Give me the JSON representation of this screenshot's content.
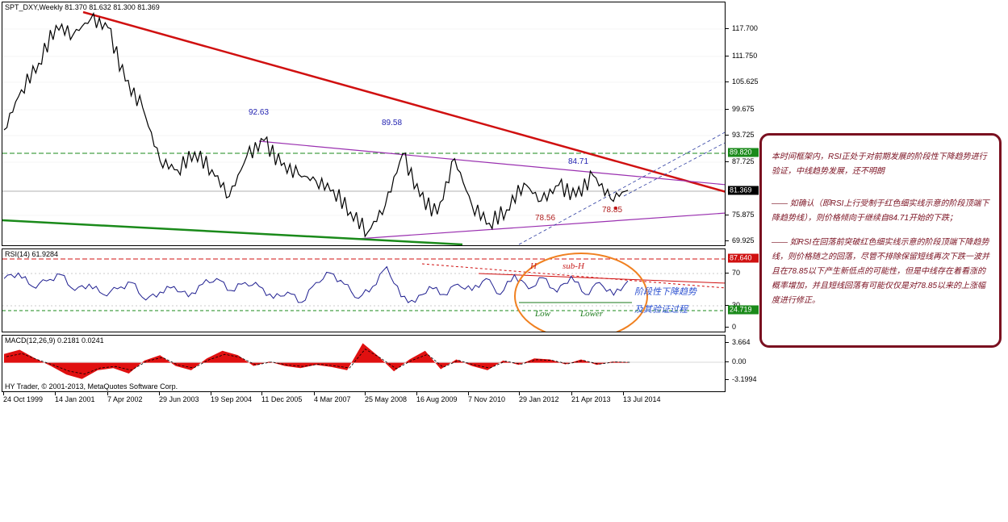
{
  "chart": {
    "title": "SPT_DXY,Weekly  81.370 81.632 81.300 81.369",
    "price_axis": [
      "117.700",
      "111.750",
      "105.625",
      "99.675",
      "93.725",
      "87.725",
      "75.875",
      "69.925"
    ],
    "price_badges": {
      "green_level": "89.820",
      "current_price": "81.369"
    },
    "annotations": {
      "peak1": "92.63",
      "peak2": "89.58",
      "peak3": "84.71",
      "low1": "78.56",
      "low2": "78.85"
    },
    "colors": {
      "downtrend_line": "#d01010",
      "purple_channel": "#9a30b0",
      "green_support": "#1a8a1a",
      "price": "#000000"
    },
    "chart_data": {
      "type": "line",
      "title": "SPT_DXY,Weekly",
      "x_labels": [
        "24 Oct 1999",
        "14 Jan 2001",
        "7 Apr 2002",
        "29 Jun 2003",
        "19 Sep 2004",
        "11 Dec 2005",
        "4 Mar 2007",
        "25 May 2008",
        "16 Aug 2009",
        "7 Nov 2010",
        "29 Jan 2012",
        "21 Apr 2013",
        "13 Jul 2014"
      ],
      "series": [
        {
          "values": [
            95.0,
            104.0,
            110.0,
            118.5,
            116.5,
            120.0,
            118.0,
            106.0,
            100.0,
            88.0,
            86.0,
            90.0,
            86.0,
            80.0,
            89.0,
            92.6,
            87.0,
            85.0,
            83.5,
            81.5,
            76.5,
            72.0,
            78.0,
            89.6,
            80.0,
            76.0,
            88.5,
            78.0,
            74.0,
            77.0,
            83.0,
            79.0,
            82.5,
            80.0,
            84.7,
            79.5,
            81.4
          ]
        }
      ],
      "ylim": [
        69.925,
        117.7
      ]
    }
  },
  "rsi": {
    "title": "RSI(14) 61.9284",
    "axis": [
      "70",
      "30",
      "0"
    ],
    "badges": {
      "upper": "87.640",
      "lower": "24.719"
    },
    "labels": {
      "H": "H",
      "subH": "sub-H",
      "low": "Low",
      "lower": "Lower",
      "note1": "阶段性下降趋势",
      "note2": "及其验证过程"
    },
    "chart_data": {
      "type": "line",
      "title": "RSI(14) 61.9284",
      "values": [
        65,
        72,
        55,
        62,
        70,
        50,
        58,
        45,
        52,
        60,
        38,
        48,
        55,
        42,
        58,
        65,
        50,
        60,
        55,
        40,
        48,
        35,
        60,
        72,
        58,
        40,
        55,
        80,
        42,
        35,
        55,
        45,
        58,
        50,
        65,
        45,
        70,
        52,
        66,
        48,
        68,
        45,
        60,
        44,
        62
      ],
      "ylim": [
        0,
        100
      ]
    }
  },
  "macd": {
    "title": "MACD(12,26,9) 0.2181 0.0241",
    "axis": [
      "3.664",
      "0.00",
      "-3.1994"
    ],
    "chart_data": {
      "type": "bar",
      "title": "MACD(12,26,9) 0.2181 0.0241",
      "values": [
        1.6,
        2.4,
        0.8,
        -0.6,
        -2.2,
        -3.0,
        -1.4,
        -1.0,
        -2.0,
        0.4,
        1.4,
        -0.6,
        -1.4,
        0.8,
        2.2,
        1.4,
        -0.6,
        0.2,
        -0.6,
        -1.0,
        -0.4,
        -0.8,
        -1.4,
        3.6,
        1.2,
        -1.6,
        0.6,
        2.2,
        -1.2,
        0.6,
        -0.6,
        -1.4,
        0.4,
        -0.4,
        0.8,
        0.6,
        -0.3,
        0.6,
        -0.4,
        0.2,
        0.1
      ],
      "ylim": [
        -3.1994,
        3.664
      ]
    }
  },
  "footer": {
    "copyright": "HY Trader, © 2001-2013, MetaQuotes Software Corp."
  },
  "commentary": {
    "p1": "本时间框架内，RSI正处于对前期发展的阶段性下降趋势进行验证，中线趋势发展，还不明朗",
    "p2": "—— 如确认（即RSI上行受制于红色细实线示意的阶段顶端下降趋势线），则价格倾向于继续自84.71开始的下跌；",
    "p3": "—— 如RSI在回落前突破红色细实线示意的阶段顶端下降趋势线，则价格随之的回落，尽管不排除保留短线再次下跌一波并且在78.85以下产生新低点的可能性，但是中线存在着看涨的概率增加，并且短线回落有可能仅仅是对78.85以来的上涨幅度进行修正。"
  }
}
